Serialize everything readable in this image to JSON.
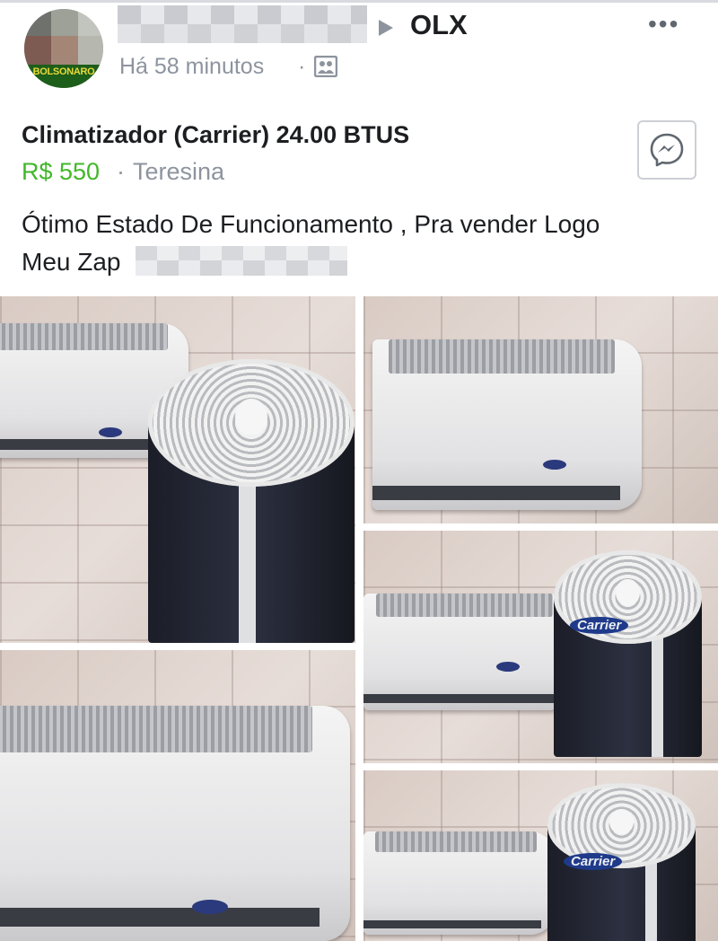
{
  "post": {
    "author_blurred": true,
    "group_name": "OLX",
    "time": "Há 58 minutos",
    "separator": "·",
    "avatar_text": "BOLSONARO",
    "more_label": "•••"
  },
  "listing": {
    "title": "Climatizador (Carrier) 24.00 BTUS",
    "price": "R$ 550",
    "separator": "·",
    "location": "Teresina",
    "description_line1": "Ótimo Estado De Funcionamento , Pra vender Logo",
    "description_line2": "Meu Zap",
    "phone_blurred": true
  },
  "photos": [
    {
      "subject": "outdoor condenser and indoor unit",
      "brand": ""
    },
    {
      "subject": "indoor split unit",
      "brand": ""
    },
    {
      "subject": "indoor unit and condenser",
      "brand": "Carrier"
    },
    {
      "subject": "indoor split unit close-up",
      "brand": ""
    },
    {
      "subject": "indoor unit and condenser",
      "brand": "Carrier"
    }
  ],
  "icons": {
    "more": "more-options-icon",
    "arrow": "arrow-right-icon",
    "audience": "group-audience-icon",
    "messenger": "messenger-icon"
  },
  "colors": {
    "price": "#42b72a",
    "secondary_text": "#8d949e",
    "primary_text": "#1c1e21"
  }
}
